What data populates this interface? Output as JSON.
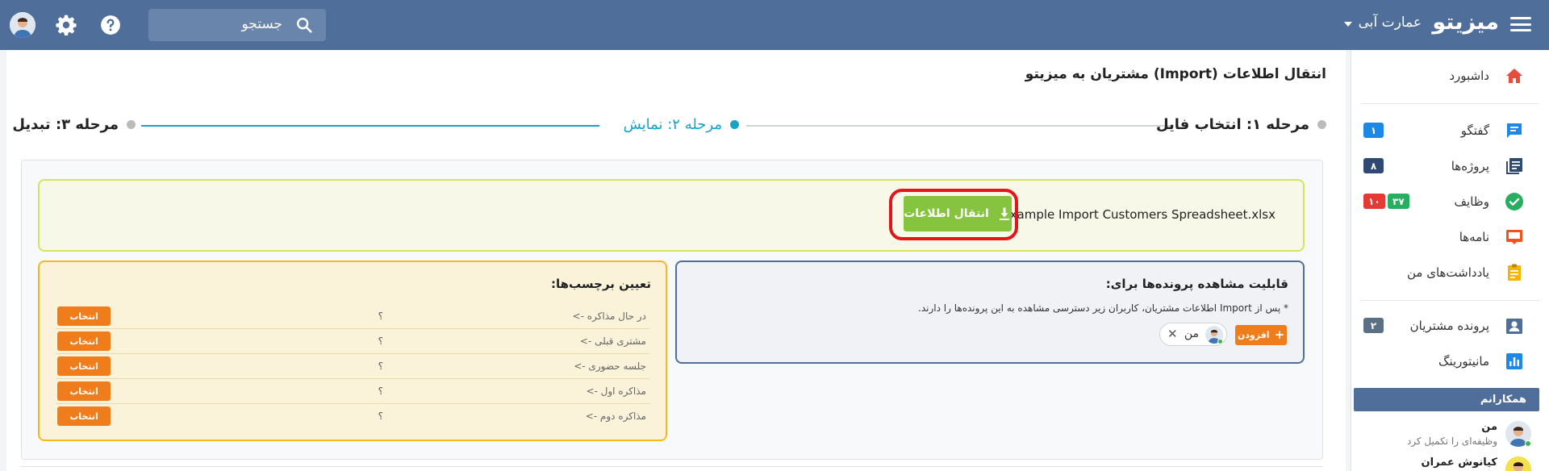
{
  "topbar": {
    "brand": "میزیتو",
    "company": "عمارت آبی",
    "search_placeholder": "جستجو"
  },
  "sidebar": {
    "items": [
      {
        "label": "داشبورد",
        "icon": "home-icon",
        "color": "#e74c3c"
      },
      {
        "label": "گفتگو",
        "icon": "chat-icon",
        "color": "#1e88e5",
        "badges": [
          {
            "text": "۱",
            "color": "#1e88e5"
          }
        ]
      },
      {
        "label": "پروژه‌ها",
        "icon": "projects-icon",
        "color": "#2e4a73",
        "badges": [
          {
            "text": "۸",
            "color": "#2e4a73"
          }
        ]
      },
      {
        "label": "وظایف",
        "icon": "tasks-icon",
        "color": "#27ae60",
        "badges": [
          {
            "text": "۳۷",
            "color": "#27ae60"
          },
          {
            "text": "۱۰",
            "color": "#e53935"
          }
        ]
      },
      {
        "label": "نامه‌ها",
        "icon": "letters-icon",
        "color": "#f4511e"
      },
      {
        "label": "یادداشت‌های من",
        "icon": "notes-icon",
        "color": "#f6b400"
      },
      {
        "label": "پرونده مشتریان",
        "icon": "customers-icon",
        "color": "#4f6f9a",
        "badges": [
          {
            "text": "۲",
            "color": "#5b6f85"
          }
        ]
      },
      {
        "label": "مانیتورینگ",
        "icon": "monitoring-icon",
        "color": "#1e88e5"
      }
    ],
    "colleagues_title": "همکارانم",
    "colleagues": [
      {
        "name": "من",
        "status": "وظیفه‌ای را تکمیل کرد"
      },
      {
        "name": "کیانوش عمران",
        "status": ""
      }
    ]
  },
  "main": {
    "title": "انتقال اطلاعات (Import) مشتریان به میزیتو",
    "steps": [
      {
        "label": "مرحله ۱: انتخاب فایل",
        "state": "done"
      },
      {
        "label": "مرحله ۲: نمایش",
        "state": "active"
      },
      {
        "label": "مرحله ۳: تبدیل",
        "state": "pending"
      }
    ],
    "file_name": "Example Import Customers Spreadsheet.xlsx",
    "import_button": "انتقال اطلاعات",
    "visibility": {
      "title": "قابلیت مشاهده پرونده‌ها برای:",
      "note": "* پس از Import اطلاعات مشتریان، کاربران زیر دسترسی مشاهده به این پرونده‌ها را دارند.",
      "add_button": "افزودن",
      "chip_name": "من"
    },
    "tags": {
      "title": "تعیین برچسب‌ها:",
      "rows": [
        {
          "name": "در حال مذاکره ->",
          "value": "؟",
          "button": "انتخاب"
        },
        {
          "name": "مشتری قبلی ->",
          "value": "؟",
          "button": "انتخاب"
        },
        {
          "name": "جلسه حضوری ->",
          "value": "؟",
          "button": "انتخاب"
        },
        {
          "name": "مذاکره اول ->",
          "value": "؟",
          "button": "انتخاب"
        },
        {
          "name": "مذاکره دوم ->",
          "value": "؟",
          "button": "انتخاب"
        }
      ]
    }
  },
  "colors": {
    "header": "#4f6f9a",
    "accent": "#17a2c8",
    "import_green": "#86c440",
    "orange": "#f07d1b",
    "highlight_red": "#e3151b"
  }
}
